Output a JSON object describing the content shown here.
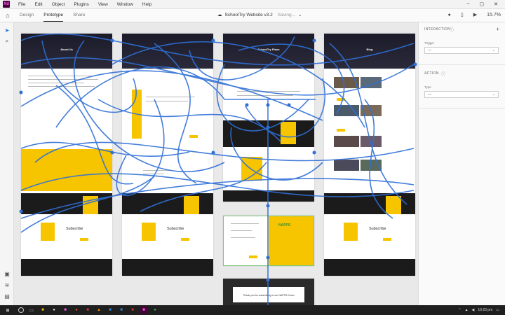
{
  "titlebar": {
    "logo": "Xd",
    "menu": [
      "File",
      "Edit",
      "Object",
      "Plugins",
      "View",
      "Window",
      "Help"
    ],
    "controls": [
      "–",
      "▢",
      "✕"
    ]
  },
  "toolbar": {
    "tabs": [
      "Design",
      "Prototype",
      "Share"
    ],
    "active_tab": "Prototype",
    "document_title": "SchoolTry Website v3.2",
    "document_status": "Saving...",
    "zoom": "15.7%"
  },
  "panel": {
    "interaction_heading": "INTERACTION",
    "trigger_label": "Trigger",
    "trigger_value": "—",
    "action_heading": "ACTION",
    "type_label": "Type",
    "type_value": "—",
    "add_symbol": "+"
  },
  "canvas": {
    "artboard_hero_titles": [
      "About Us",
      "",
      "SchoolTry Plans",
      "Blog"
    ],
    "subscribe_label": "Subscribe",
    "napps_label": "NAPPS",
    "thankyou_text": "Thank you for subscribing to our NAPPS Demo"
  },
  "taskbar": {
    "time": "10:23 pm"
  },
  "colors": {
    "accent_yellow": "#f7c500",
    "wire_blue": "#2f6fd6",
    "xd_purple": "#470137",
    "xd_pink": "#ff61f6"
  }
}
